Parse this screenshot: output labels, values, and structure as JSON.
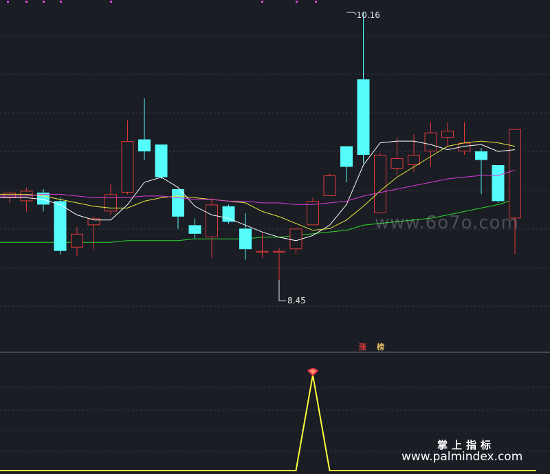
{
  "colors": {
    "background": "#1a1d24",
    "grid": "#3c4150",
    "separator": "#6a7080",
    "up": "#e0393b",
    "down": "#54fcfc",
    "ma5": "#ffffff",
    "ma10": "#e8e83a",
    "ma20": "#d83cd8",
    "ma60": "#2ed82e",
    "indicator": "#ffff3c",
    "tag_zhang_bg": "#c0231d",
    "tag_bang_bg": "#c8a060"
  },
  "annotations": {
    "high_label": "10.16",
    "low_label": "8.45"
  },
  "tags": {
    "zhang": "涨",
    "bang": "榜"
  },
  "watermark": "www.6o7o.com",
  "footer": {
    "line1": "掌上指标",
    "line2": "www.palmindex.com"
  },
  "chart_data": {
    "type": "candlestick",
    "y_range": [
      8.3,
      10.2
    ],
    "candles": [
      {
        "o": 9.08,
        "h": 9.1,
        "l": 9.05,
        "c": 9.11
      },
      {
        "o": 9.06,
        "h": 9.14,
        "l": 9.0,
        "c": 9.12
      },
      {
        "o": 9.11,
        "h": 9.13,
        "l": 9.0,
        "c": 9.04
      },
      {
        "o": 9.06,
        "h": 9.08,
        "l": 8.75,
        "c": 8.77
      },
      {
        "o": 8.79,
        "h": 8.91,
        "l": 8.74,
        "c": 8.87
      },
      {
        "o": 8.92,
        "h": 8.97,
        "l": 8.78,
        "c": 8.96
      },
      {
        "o": 9.0,
        "h": 9.16,
        "l": 8.98,
        "c": 9.1
      },
      {
        "o": 9.11,
        "h": 9.53,
        "l": 9.1,
        "c": 9.41
      },
      {
        "o": 9.42,
        "h": 9.66,
        "l": 9.3,
        "c": 9.35
      },
      {
        "o": 9.39,
        "h": 9.39,
        "l": 9.19,
        "c": 9.2
      },
      {
        "o": 9.13,
        "h": 9.13,
        "l": 8.9,
        "c": 8.97
      },
      {
        "o": 8.92,
        "h": 8.96,
        "l": 8.84,
        "c": 8.87
      },
      {
        "o": 8.85,
        "h": 9.08,
        "l": 8.73,
        "c": 9.04
      },
      {
        "o": 9.03,
        "h": 9.04,
        "l": 8.93,
        "c": 8.94
      },
      {
        "o": 8.9,
        "h": 8.99,
        "l": 8.72,
        "c": 8.78
      },
      {
        "o": 8.76,
        "h": 8.87,
        "l": 8.73,
        "c": 8.77
      },
      {
        "o": 8.76,
        "h": 8.79,
        "l": 8.6,
        "c": 8.77
      },
      {
        "o": 8.78,
        "h": 8.89,
        "l": 8.75,
        "c": 8.9
      },
      {
        "o": 8.92,
        "h": 9.08,
        "l": 8.92,
        "c": 9.06
      },
      {
        "o": 9.09,
        "h": 9.22,
        "l": 9.09,
        "c": 9.21
      },
      {
        "o": 9.38,
        "h": 9.38,
        "l": 9.17,
        "c": 9.26
      },
      {
        "o": 9.77,
        "h": 10.16,
        "l": 9.28,
        "c": 9.33
      },
      {
        "o": 8.99,
        "h": 9.34,
        "l": 8.99,
        "c": 9.33
      },
      {
        "o": 9.25,
        "h": 9.43,
        "l": 9.21,
        "c": 9.31
      },
      {
        "o": 9.27,
        "h": 9.45,
        "l": 9.23,
        "c": 9.33
      },
      {
        "o": 9.35,
        "h": 9.52,
        "l": 9.26,
        "c": 9.46
      },
      {
        "o": 9.43,
        "h": 9.52,
        "l": 9.38,
        "c": 9.47
      },
      {
        "o": 9.35,
        "h": 9.52,
        "l": 9.33,
        "c": 9.4
      },
      {
        "o": 9.35,
        "h": 9.37,
        "l": 9.1,
        "c": 9.3
      },
      {
        "o": 9.27,
        "h": 9.27,
        "l": 9.05,
        "c": 9.06
      },
      {
        "o": 8.96,
        "h": 9.48,
        "l": 8.75,
        "c": 9.48
      }
    ],
    "ma_series": [
      {
        "key": "ma5",
        "values": [
          9.08,
          9.08,
          9.07,
          9.04,
          8.98,
          8.95,
          8.95,
          9.04,
          9.17,
          9.2,
          9.14,
          9.03,
          8.98,
          8.96,
          8.92,
          8.88,
          8.85,
          8.83,
          8.86,
          8.92,
          9.04,
          9.27,
          9.4,
          9.41,
          9.41,
          9.39,
          9.36,
          9.38,
          9.39,
          9.35,
          9.36
        ]
      },
      {
        "key": "ma10",
        "values": [
          9.1,
          9.1,
          9.09,
          9.07,
          9.05,
          9.03,
          9.02,
          9.02,
          9.06,
          9.08,
          9.09,
          9.08,
          9.07,
          9.06,
          9.05,
          9.0,
          8.97,
          8.93,
          8.89,
          8.9,
          8.95,
          9.03,
          9.12,
          9.2,
          9.26,
          9.32,
          9.38,
          9.4,
          9.41,
          9.4,
          9.38
        ]
      },
      {
        "key": "ma20",
        "values": [
          9.09,
          9.09,
          9.1,
          9.1,
          9.09,
          9.08,
          9.08,
          9.08,
          9.09,
          9.09,
          9.08,
          9.07,
          9.07,
          9.06,
          9.06,
          9.05,
          9.05,
          9.04,
          9.04,
          9.05,
          9.06,
          9.09,
          9.11,
          9.13,
          9.15,
          9.17,
          9.19,
          9.2,
          9.21,
          9.21,
          9.24
        ]
      },
      {
        "key": "ma60",
        "values": [
          8.82,
          8.82,
          8.82,
          8.82,
          8.82,
          8.82,
          8.82,
          8.83,
          8.83,
          8.83,
          8.83,
          8.84,
          8.84,
          8.84,
          8.84,
          8.85,
          8.85,
          8.86,
          8.87,
          8.88,
          8.89,
          8.92,
          8.93,
          8.94,
          8.95,
          8.96,
          8.98,
          9.0,
          9.02,
          9.04,
          9.07
        ]
      }
    ],
    "indicator": {
      "y_range": [
        0,
        1
      ],
      "values": [
        0,
        0,
        0,
        0,
        0,
        0,
        0,
        0,
        0,
        0,
        0,
        0,
        0,
        0,
        0,
        0,
        0,
        0,
        1,
        0,
        0,
        0,
        0,
        0,
        0,
        0,
        0,
        0,
        0,
        0,
        0
      ],
      "signal_index": 18
    },
    "high_index": 21,
    "low_index": 16
  }
}
